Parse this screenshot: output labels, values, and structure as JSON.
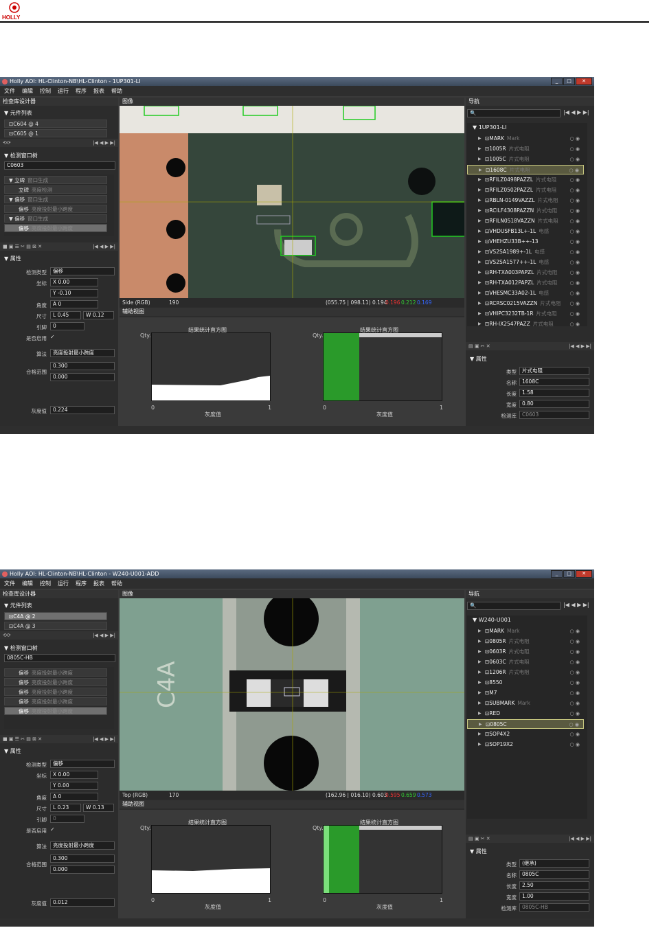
{
  "header": {
    "logo_text": "HOLLY"
  },
  "screen1": {
    "title": "Holly AOI: HL-Clinton-NB\\HL-Clinton - 1UP301-LI",
    "menu": [
      "文件",
      "编辑",
      "控制",
      "运行",
      "程序",
      "报表",
      "帮助"
    ],
    "left_title": "检查库设计器",
    "component_list_title": "元件列表",
    "components": [
      "C604 @ 4",
      "C605 @ 1"
    ],
    "window_title": "检测窗口树",
    "part": "C0603",
    "tree": [
      {
        "a": "立碑",
        "b": "窗口生成"
      },
      {
        "a": "立碑",
        "b": "亮度检测"
      },
      {
        "a": "偏移",
        "b": "窗口生成"
      },
      {
        "a": "偏移",
        "b": "亮度投射最小跨度"
      },
      {
        "a": "偏移",
        "b": "窗口生成"
      },
      {
        "a": "偏移",
        "b": "亮度投射最小跨度"
      }
    ],
    "props_title": "属性",
    "detect_type_label": "检测类型",
    "detect_type": "偏移",
    "coord_label": "坐标",
    "x": "0.00",
    "y": "-0.10",
    "angle_label": "角度",
    "angle": "0",
    "size_label": "尺寸",
    "l": "0.45",
    "w": "0.12",
    "lead_label": "引脚",
    "lead": "0",
    "enable_label": "是否启用",
    "algo_label": "算法",
    "algo": "亮度投射最小跨度",
    "range_label": "合格范围",
    "range_hi": "0.300",
    "range_lo": "0.000",
    "gray_label": "灰度值",
    "gray": "0.224",
    "image_title": "图像",
    "view": "Side (RGB)",
    "view_val": "190",
    "readout": "(055.75 | 098.11) 0.194",
    "r": "0.196",
    "g": "0.212",
    "b": "0.169",
    "aux_title": "辅助视图",
    "hist1_title": "结果统计直方图",
    "hist2_title": "结果统计直方图",
    "qty": "Qty.",
    "x0": "0",
    "x1": "1",
    "xlab": "灰度值",
    "nav_title": "导航",
    "nav_root": "1UP301-LI",
    "nav_items": [
      {
        "n": "MARK",
        "t": "Mark"
      },
      {
        "n": "1005R",
        "t": "片式电阻"
      },
      {
        "n": "1005C",
        "t": "片式电阻"
      },
      {
        "n": "1608C",
        "t": "片式电阻"
      },
      {
        "n": "RFILZ0498PAZZL",
        "t": "片式电阻"
      },
      {
        "n": "RFILZ0502PAZZL",
        "t": "片式电阻"
      },
      {
        "n": "RBLN-0149VAZZL",
        "t": "片式电阻"
      },
      {
        "n": "RCILF4308PAZZN",
        "t": "片式电阻"
      },
      {
        "n": "RFILN0518VAZZN",
        "t": "片式电阻"
      },
      {
        "n": "VHDUSFB13L+-1L",
        "t": "电感"
      },
      {
        "n": "VHEHZU33B++-13",
        "t": ""
      },
      {
        "n": "VS2SA1989+-1L",
        "t": "电感"
      },
      {
        "n": "VS2SA1577++-1L",
        "t": "电感"
      },
      {
        "n": "RH-TXA003PAPZL",
        "t": "片式电阻"
      },
      {
        "n": "RH-TXA012PAPZL",
        "t": "片式电阻"
      },
      {
        "n": "VHESMC33A02-1L",
        "t": "电感"
      },
      {
        "n": "RCRSC0215VAZZN",
        "t": "片式电阻"
      },
      {
        "n": "VHIPC3232TB-1R",
        "t": "片式电阻"
      },
      {
        "n": "RH-IX2547PAZZ",
        "t": "片式电阻"
      }
    ],
    "nprops_title": "属性",
    "type_label": "类型",
    "type": "片式电阻",
    "name_label": "名称",
    "name": "1608C",
    "len_label": "长度",
    "len": "1.58",
    "wid_label": "宽度",
    "wid": "0.80",
    "lib_label": "检测库",
    "lib": "C0603"
  },
  "screen2": {
    "title": "Holly AOI: HL-Clinton-NB\\HL-Clinton - W240-U001-ADD",
    "menu": [
      "文件",
      "编辑",
      "控制",
      "运行",
      "程序",
      "报表",
      "帮助"
    ],
    "left_title": "检查库设计器",
    "component_list_title": "元件列表",
    "components": [
      "C4A @ 2",
      "C4A @ 3"
    ],
    "window_title": "检测窗口树",
    "part": "0805C-HB",
    "tree": [
      {
        "a": "偏移",
        "b": "亮度投射最小跨度"
      },
      {
        "a": "偏移",
        "b": "亮度投射最小跨度"
      },
      {
        "a": "偏移",
        "b": "亮度投射最小跨度"
      },
      {
        "a": "偏移",
        "b": "亮度投射最小跨度"
      },
      {
        "a": "偏移",
        "b": "亮度投射最小跨度"
      }
    ],
    "props_title": "属性",
    "detect_type_label": "检测类型",
    "detect_type": "偏移",
    "coord_label": "坐标",
    "x": "0.00",
    "y": "0.00",
    "angle_label": "角度",
    "angle": "0",
    "size_label": "尺寸",
    "l": "0.23",
    "w": "0.13",
    "lead_label": "引脚",
    "lead": "0",
    "enable_label": "是否启用",
    "algo_label": "算法",
    "algo": "亮度投射最小跨度",
    "range_label": "合格范围",
    "range_hi": "0.300",
    "range_lo": "0.000",
    "gray_label": "灰度值",
    "gray": "0.012",
    "image_title": "图像",
    "view": "Top (RGB)",
    "view_val": "170",
    "readout": "(162.96 | 016.10) 0.603",
    "r": "0.595",
    "g": "0.659",
    "b": "0.573",
    "aux_title": "辅助视图",
    "hist1_title": "结果统计直方图",
    "hist2_title": "结果统计直方图",
    "qty": "Qty.",
    "x0": "0",
    "x1": "1",
    "xlab": "灰度值",
    "nav_title": "导航",
    "nav_root": "W240-U001",
    "nav_items": [
      {
        "n": "MARK",
        "t": "Mark"
      },
      {
        "n": "0805R",
        "t": "片式电阻"
      },
      {
        "n": "0603R",
        "t": "片式电阻"
      },
      {
        "n": "0603C",
        "t": "片式电阻"
      },
      {
        "n": "1206R",
        "t": "片式电阻"
      },
      {
        "n": "8550",
        "t": ""
      },
      {
        "n": "M7",
        "t": ""
      },
      {
        "n": "SUBMARK",
        "t": "Mark"
      },
      {
        "n": "RED",
        "t": ""
      },
      {
        "n": "0805C",
        "t": ""
      },
      {
        "n": "SOP4X2",
        "t": ""
      },
      {
        "n": "SOP19X2",
        "t": ""
      }
    ],
    "nprops_title": "属性",
    "type_label": "类型",
    "type": "(继承)",
    "name_label": "名称",
    "name": "0805C",
    "len_label": "长度",
    "len": "2.50",
    "wid_label": "宽度",
    "wid": "1.00",
    "lib_label": "检测库",
    "lib": "0805C-HB"
  }
}
